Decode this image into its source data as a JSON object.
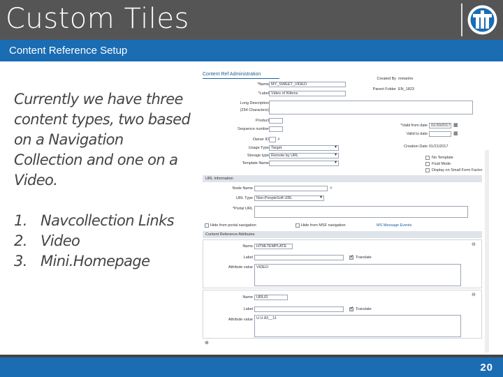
{
  "slide": {
    "title": "Custom Tiles",
    "subtitle": "Content Reference Setup",
    "body_text": "Currently we have three content types, two based on a Navigation Collection and one on a Video.",
    "list": [
      {
        "num": "1.",
        "text": "Navcollection Links"
      },
      {
        "num": "2.",
        "text": "Video"
      },
      {
        "num": "3.",
        "text": "Mini.Homepage"
      }
    ],
    "page_number": "20",
    "colors": {
      "title_bar": "#555555",
      "accent": "#1a6cb3"
    }
  },
  "screenshot": {
    "header": "Content Ref Administration",
    "name_label": "*Name",
    "name_value": "MY_SWEET_VIDEO",
    "label_label": "*Label",
    "label_value": "Video of Kittens",
    "long_desc_label": "Long Description",
    "long_desc_hint": "(254 Characters)",
    "product_label": "Product",
    "sequence_label": "Sequence number",
    "owner_label": "Owner ID",
    "usage_label": "Usage Type",
    "usage_value": "Target",
    "storage_label": "Storage type",
    "storage_value": "Remote by URL",
    "template_label": "Template Name",
    "created_by_label": "Created By",
    "created_by_value": "mmanhe",
    "parent_folder_label": "Parent Folder",
    "parent_folder_value": "EN_1823",
    "valid_from_label": "*Valid from date",
    "valid_from_value": "01/30/2017",
    "valid_to_label": "Valid to date",
    "creation_date_label": "Creation Date",
    "creation_date_value": "01/21/2017",
    "no_template": "No Template",
    "fluid_mode": "Fluid Mode",
    "display_small": "Display on Small Form Factor",
    "url_section": "URL Information",
    "node_name_label": "Node Name",
    "url_type_label": "URL Type",
    "url_type_value": "Non-PeopleSoft URL",
    "portal_url_label": "*Portal URL",
    "hide_portal_nav": "Hide from portal navigation",
    "hide_msft_nav": "Hide from MSF navigation",
    "ms_message_events": "MS Message Events",
    "attr_section": "Content Reference Attributes",
    "attr1_name_label": "Name",
    "attr1_name_value": "HTMLTEMPLATE",
    "attr1_label_label": "Label",
    "attr1_translate": "Translate",
    "attr1_value_label": "Attribute value",
    "attr1_value_value": "VIDEO",
    "attr2_name_label": "Name",
    "attr2_name_value": "URLID",
    "attr2_label_label": "Label",
    "attr2_translate": "Translate",
    "attr2_value_label": "Attribute value",
    "attr2_value_value": "U.U.83__11"
  }
}
